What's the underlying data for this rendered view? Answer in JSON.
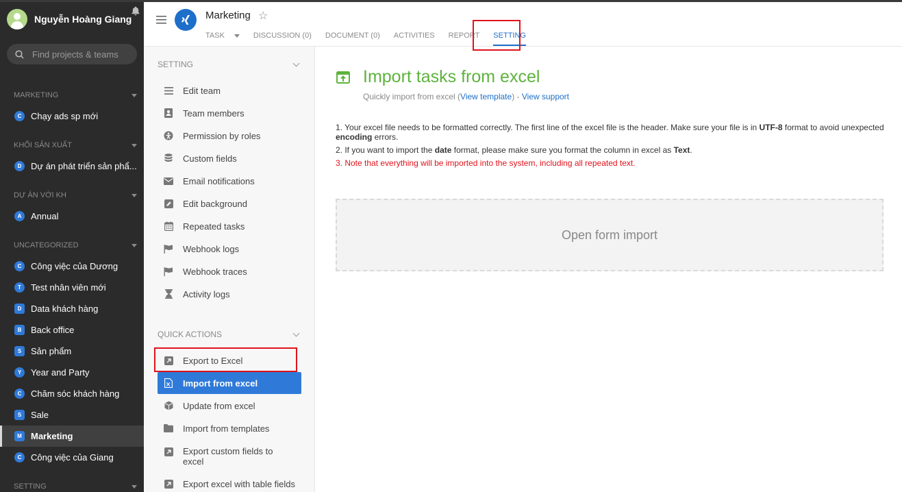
{
  "user": {
    "name": "Nguyễn Hoàng Giang"
  },
  "search": {
    "placeholder": "Find projects & teams"
  },
  "sidebar": {
    "groups": [
      {
        "title": "MARKETING",
        "items": [
          {
            "badge": "C",
            "label": "Chạy ads sp mới"
          }
        ]
      },
      {
        "title": "KHỐI SẢN XUẤT",
        "items": [
          {
            "badge": "D",
            "label": "Dự án phát triển sản phẩ..."
          }
        ]
      },
      {
        "title": "DỰ ÁN VỚI KH",
        "items": [
          {
            "badge": "A",
            "label": "Annual"
          }
        ]
      },
      {
        "title": "UNCATEGORIZED",
        "items": [
          {
            "badge": "C",
            "label": "Công việc của Dương"
          },
          {
            "badge": "T",
            "label": "Test nhân viên mới"
          },
          {
            "badge": "D",
            "label": "Data khách hàng"
          },
          {
            "badge": "B",
            "label": "Back office"
          },
          {
            "badge": "S",
            "label": "Sản phẩm"
          },
          {
            "badge": "Y",
            "label": "Year and Party"
          },
          {
            "badge": "C",
            "label": "Chăm sóc khách hàng"
          },
          {
            "badge": "S",
            "label": "Sale"
          },
          {
            "badge": "M",
            "label": "Marketing"
          },
          {
            "badge": "C",
            "label": "Công việc của Giang"
          }
        ]
      },
      {
        "title": "SETTING",
        "items": []
      }
    ]
  },
  "header": {
    "project": "Marketing",
    "tabs": [
      "TASK",
      "DISCUSSION (0)",
      "DOCUMENT (0)",
      "ACTIVITIES",
      "REPORT",
      "SETTING"
    ]
  },
  "panel": {
    "setting_title": "SETTING",
    "setting_items": [
      "Edit team",
      "Team members",
      "Permission by roles",
      "Custom fields",
      "Email notifications",
      "Edit background",
      "Repeated tasks",
      "Webhook logs",
      "Webhook traces",
      "Activity logs"
    ],
    "quick_title": "QUICK ACTIONS",
    "quick_items": [
      "Export to Excel",
      "Import from excel",
      "Update from excel",
      "Import from templates",
      "Export custom fields to excel",
      "Export excel with table fields"
    ]
  },
  "main": {
    "title": "Import tasks from excel",
    "sub_prefix": "Quickly import from excel (",
    "view_template": "View template",
    "sub_mid": ") - ",
    "view_support": "View support",
    "note1_a": "1. Your excel file needs to be formatted correctly. The first line of the excel file is the header. Make sure your file is in ",
    "note1_b": "UTF-8",
    "note1_c": " format to avoid unexpected ",
    "note1_d": "encoding",
    "note1_e": " errors.",
    "note2_a": "2. If you want to import the ",
    "note2_b": "date",
    "note2_c": " format, please make sure you format the column in excel as ",
    "note2_d": "Text",
    "note2_e": ".",
    "note3": "3. Note that everything will be imported into the system, including all repeated text.",
    "open_form": "Open form import"
  },
  "colors": {
    "accent": "#2f7ad9",
    "title_green": "#5eb33e",
    "highlight_red": "#e0121a",
    "sidebar_bg": "#2b2b2b"
  }
}
